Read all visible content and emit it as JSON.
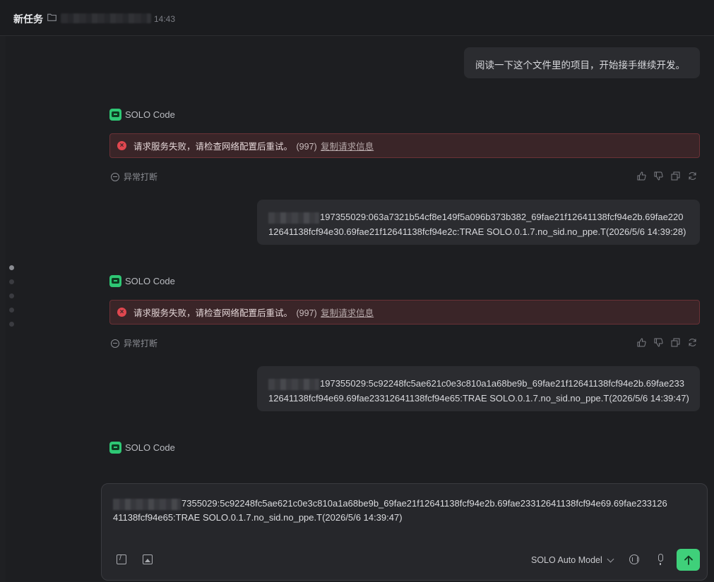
{
  "header": {
    "title": "新任务",
    "time": "14:43"
  },
  "messages": {
    "user1": "阅读一下这个文件里的项目，开始接手继续开发。",
    "bot_name": "SOLO Code",
    "error_text": "请求服务失败，请检查网络配置后重试。",
    "error_code": "(997)",
    "error_link": "复制请求信息",
    "aborted": "异常打断",
    "user2_line1": "197355029:063a7321b54cf8e149f5a096b373b382_69fae21f12641138fcf94e2b.69fae220",
    "user2_line2": "12641138fcf94e30.69fae21f12641138fcf94e2c:TRAE SOLO.0.1.7.no_sid.no_ppe.T(2026/5/6 14:39:28)",
    "user3_line1": "197355029:5c92248fc5ae621c0e3c810a1a68be9b_69fae21f12641138fcf94e2b.69fae233",
    "user3_line2": "12641138fcf94e69.69fae23312641138fcf94e65:TRAE SOLO.0.1.7.no_sid.no_ppe.T(2026/5/6 14:39:47)"
  },
  "composer": {
    "line1": "7355029:5c92248fc5ae621c0e3c810a1a68be9b_69fae21f12641138fcf94e2b.69fae23312641138fcf94e69.69fae233126",
    "line2": "41138fcf94e65:TRAE SOLO.0.1.7.no_sid.no_ppe.T(2026/5/6 14:39:47)",
    "model": "SOLO Auto Model"
  },
  "icons": [
    "folder-icon",
    "error-icon",
    "abort-icon",
    "thumbs-up-icon",
    "thumbs-down-icon",
    "copy-icon",
    "retry-icon",
    "slash-command-icon",
    "image-icon",
    "chevron-down-icon",
    "voice-chat-icon",
    "mic-icon",
    "send-arrow-icon"
  ],
  "colors": {
    "accent": "#3fd07a",
    "error_bg": "#3a2528",
    "error_border": "#6a3136"
  }
}
